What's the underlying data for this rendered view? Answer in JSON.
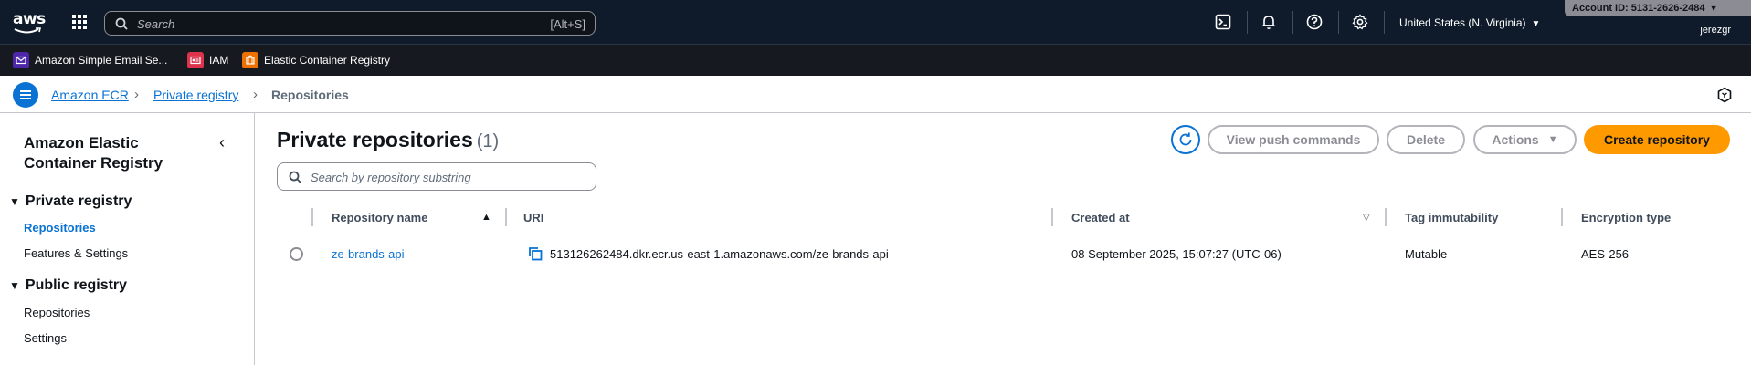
{
  "topnav": {
    "logo_text": "aws",
    "search_placeholder": "Search",
    "search_shortcut": "[Alt+S]",
    "region": "United States (N. Virginia)",
    "account": "Account ID: 5131-2626-2484",
    "user": "jerezgr"
  },
  "favorites": [
    {
      "label": "Amazon Simple Email Se...",
      "color": "#4d27aa"
    },
    {
      "label": "IAM",
      "color": "#dd344c"
    },
    {
      "label": "Elastic Container Registry",
      "color": "#ed7100"
    }
  ],
  "breadcrumb": {
    "items": [
      "Amazon ECR",
      "Private registry"
    ],
    "current": "Repositories"
  },
  "sidenav": {
    "title": "Amazon Elastic Container Registry",
    "groups": [
      {
        "label": "Private registry",
        "items": [
          "Repositories",
          "Features & Settings"
        ]
      },
      {
        "label": "Public registry",
        "items": [
          "Repositories",
          "Settings"
        ]
      }
    ]
  },
  "main": {
    "title": "Private repositories",
    "count": "(1)",
    "buttons": {
      "view_push": "View push commands",
      "delete": "Delete",
      "actions": "Actions",
      "create": "Create repository"
    },
    "search_placeholder": "Search by repository substring",
    "columns": [
      "Repository name",
      "URI",
      "Created at",
      "Tag immutability",
      "Encryption type"
    ],
    "rows": [
      {
        "name": "ze-brands-api",
        "uri": "513126262484.dkr.ecr.us-east-1.amazonaws.com/ze-brands-api",
        "created": "08 September 2025, 15:07:27 (UTC-06)",
        "immutability": "Mutable",
        "encryption": "AES-256"
      }
    ]
  },
  "colors": {
    "accent": "#0972d3",
    "primary_button": "#ff9900",
    "topnav_bg": "#0f1b2a"
  }
}
